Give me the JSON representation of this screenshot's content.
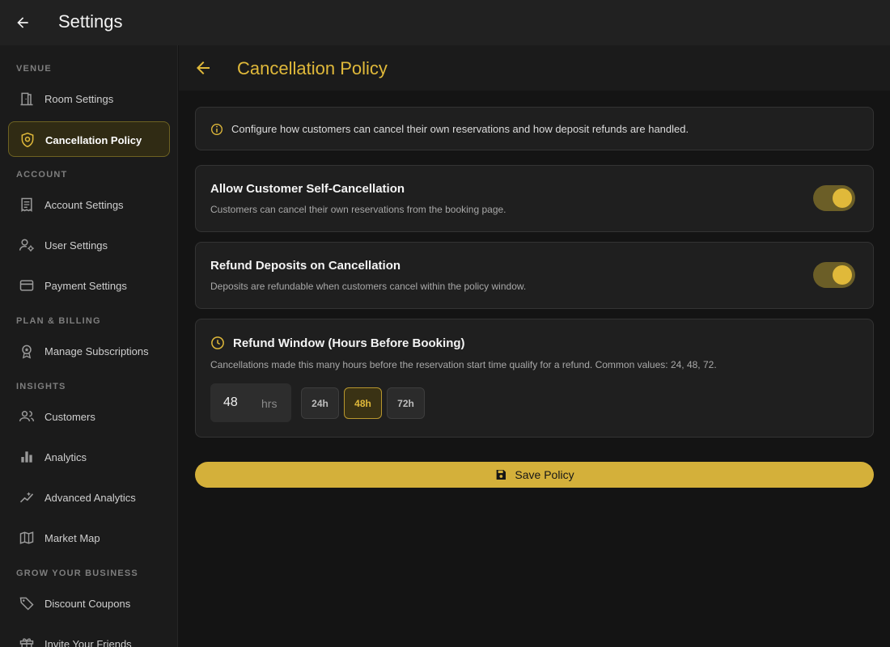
{
  "app": {
    "title": "Settings"
  },
  "sidebar": {
    "sections": [
      {
        "heading": "VENUE"
      },
      {
        "heading": "ACCOUNT"
      },
      {
        "heading": "PLAN & BILLING"
      },
      {
        "heading": "INSIGHTS"
      },
      {
        "heading": "GROW YOUR BUSINESS"
      }
    ],
    "items": [
      {
        "label": "Room Settings",
        "icon": "door-icon"
      },
      {
        "label": "Cancellation Policy",
        "icon": "shield-icon",
        "active": true
      },
      {
        "label": "Account Settings",
        "icon": "receipt-icon"
      },
      {
        "label": "User Settings",
        "icon": "user-gear-icon"
      },
      {
        "label": "Payment Settings",
        "icon": "credit-card-icon"
      },
      {
        "label": "Manage Subscriptions",
        "icon": "badge-icon"
      },
      {
        "label": "Customers",
        "icon": "people-icon"
      },
      {
        "label": "Analytics",
        "icon": "bar-chart-icon"
      },
      {
        "label": "Advanced Analytics",
        "icon": "trend-icon"
      },
      {
        "label": "Market Map",
        "icon": "map-icon"
      },
      {
        "label": "Discount Coupons",
        "icon": "tag-icon"
      },
      {
        "label": "Invite Your Friends",
        "icon": "gift-icon"
      }
    ]
  },
  "page": {
    "title": "Cancellation Policy",
    "info": "Configure how customers can cancel their own reservations and how deposit refunds are handled."
  },
  "settings": {
    "self_cancel": {
      "title": "Allow Customer Self-Cancellation",
      "description": "Customers can cancel their own reservations from the booking page.",
      "enabled": true
    },
    "refund_deposits": {
      "title": "Refund Deposits on Cancellation",
      "description": "Deposits are refundable when customers cancel within the policy window.",
      "enabled": true
    },
    "refund_window": {
      "title": "Refund Window (Hours Before Booking)",
      "description": "Cancellations made this many hours before the reservation start time qualify for a refund. Common values: 24, 48, 72.",
      "value": "48",
      "unit": "hrs",
      "presets": [
        "24h",
        "48h",
        "72h"
      ],
      "selected_preset": "48h"
    }
  },
  "actions": {
    "save_label": "Save Policy"
  },
  "colors": {
    "accent": "#e0b93a",
    "button": "#d4b03a",
    "background": "#141414"
  }
}
